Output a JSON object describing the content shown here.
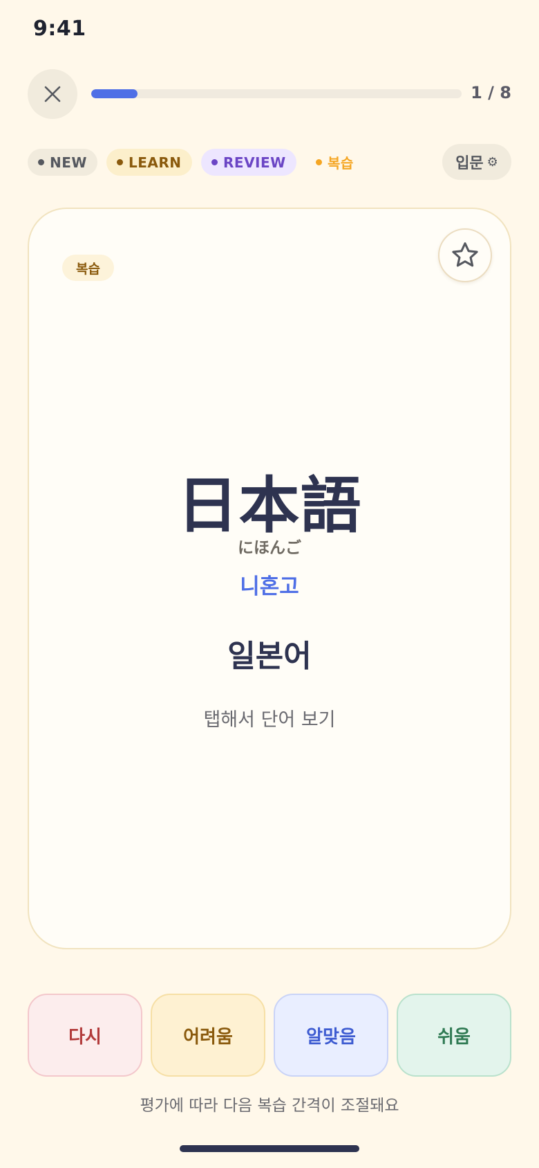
{
  "status_bar": {
    "time": "9:41"
  },
  "header": {
    "close_icon": "close-icon",
    "progress": {
      "current": 1,
      "total": 8,
      "fraction": 0.125,
      "label": "1 / 8",
      "color": "#4F6FE6"
    }
  },
  "filters": {
    "chips": [
      {
        "label": "NEW",
        "color": "#55585F"
      },
      {
        "label": "LEARN",
        "color": "#8A5A0D"
      },
      {
        "label": "REVIEW",
        "color": "#6B45C5"
      },
      {
        "label": "복습",
        "color": "#F5A623"
      }
    ],
    "level": {
      "label": "입문",
      "icon": "gear-icon",
      "glyph": "⚙"
    }
  },
  "card": {
    "badge": "복습",
    "favorite_icon": "star-icon",
    "kanji": "日本語",
    "reading": "にほんご",
    "pronunciation": "니혼고",
    "meaning": "일본어",
    "hint": "탭해서 단어 보기"
  },
  "ratings": {
    "buttons": [
      {
        "label": "다시",
        "color": "#B23B3B"
      },
      {
        "label": "어려움",
        "color": "#8A5A0D"
      },
      {
        "label": "알맞음",
        "color": "#3D5BD1"
      },
      {
        "label": "쉬움",
        "color": "#2F7A53"
      }
    ],
    "note": "평가에 따라 다음 복습 간격이 조절돼요"
  }
}
